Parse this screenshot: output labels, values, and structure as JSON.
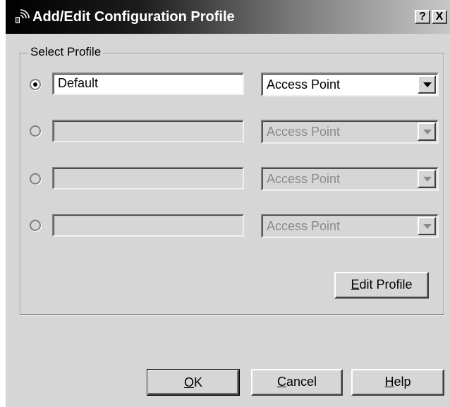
{
  "window": {
    "title": "Add/Edit Configuration Profile",
    "icon": "wireless-signal-icon",
    "help_label": "?",
    "close_label": "X"
  },
  "group": {
    "label": "Select Profile"
  },
  "profiles": [
    {
      "name": "Default",
      "type": "Access Point",
      "selected": true,
      "enabled": true
    },
    {
      "name": "",
      "type": "Access Point",
      "selected": false,
      "enabled": false
    },
    {
      "name": "",
      "type": "Access Point",
      "selected": false,
      "enabled": false
    },
    {
      "name": "",
      "type": "Access Point",
      "selected": false,
      "enabled": false
    }
  ],
  "buttons": {
    "edit_profile": {
      "mnemonic": "E",
      "rest": "dit Profile"
    },
    "ok": {
      "mnemonic": "O",
      "rest": "K"
    },
    "cancel": {
      "mnemonic": "C",
      "rest": "ancel"
    },
    "help": {
      "mnemonic": "H",
      "rest": "elp"
    }
  },
  "colors": {
    "dialog_face": "#d6d6d6",
    "title_gradient_start": "#000000",
    "title_gradient_end": "#c8c8c8",
    "disabled_text": "#8a8a8a"
  }
}
